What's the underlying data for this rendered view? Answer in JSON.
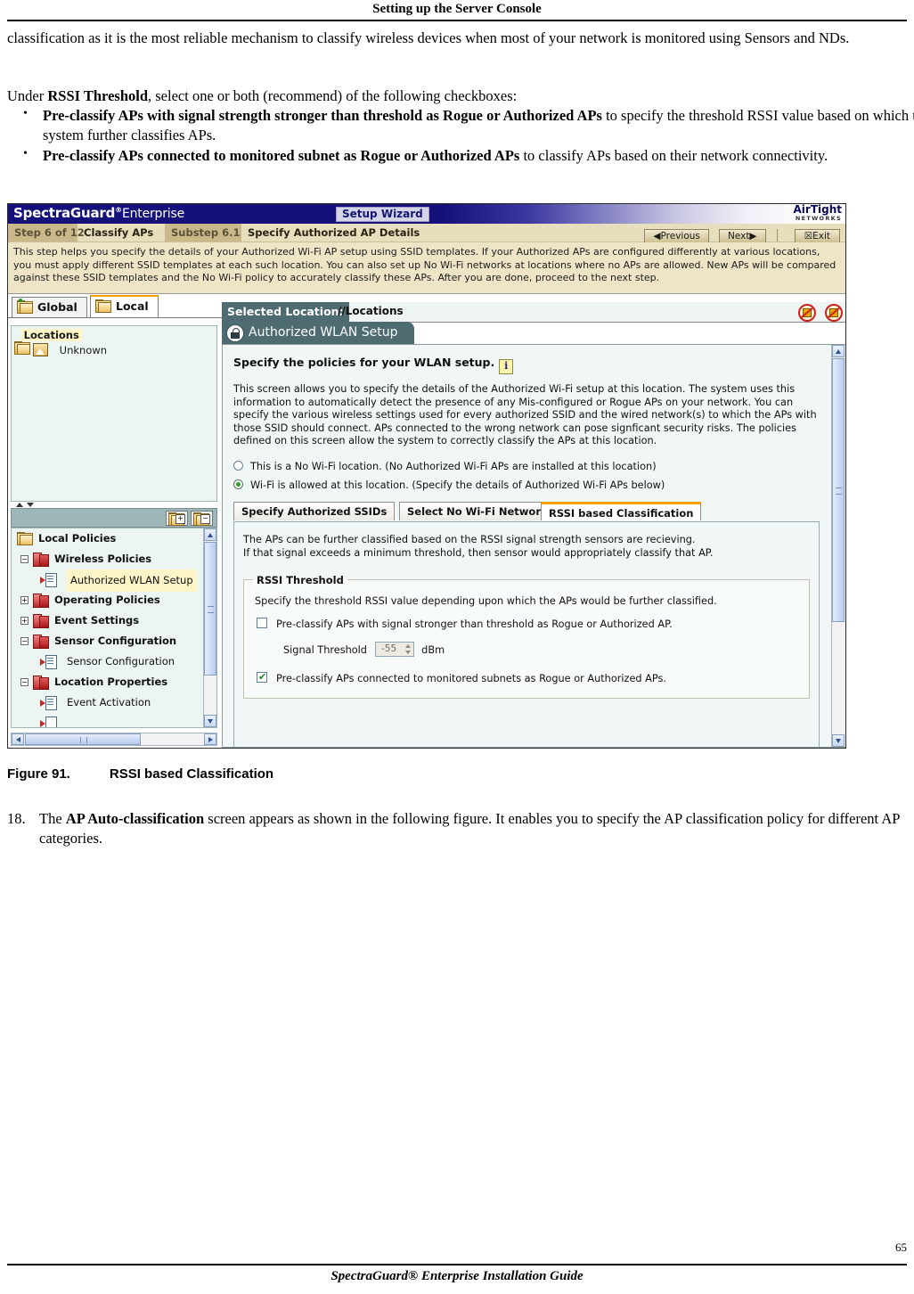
{
  "page": {
    "running_head": "Setting up the Server Console",
    "footer": "SpectraGuard®  Enterprise Installation Guide",
    "page_number": "65"
  },
  "prose": {
    "para1": "classification as it is the most reliable mechanism to classify wireless devices when most of your network is monitored using Sensors and NDs.",
    "para2_pre": "Under ",
    "para2_bold": "RSSI Threshold",
    "para2_post": ", select one or both (recommend) of the following checkboxes:",
    "bullets": [
      {
        "bold": "Pre-classify APs with signal strength stronger than threshold as Rogue or Authorized APs",
        "rest": " to specify the threshold RSSI value based on which the system further classifies APs."
      },
      {
        "bold": "Pre-classify APs connected to monitored subnet as Rogue or Authorized APs",
        "rest": " to classify APs based on their network connectivity."
      }
    ],
    "figure_label": "Figure  91.",
    "figure_title": "RSSI based Classification",
    "step_number": "18.",
    "step_pre": "The ",
    "step_bold": "AP Auto-classification",
    "step_post": " screen appears as shown in the following figure. It enables you to specify the AP classification policy for different AP categories."
  },
  "app": {
    "brand_main": "SpectraGuard",
    "brand_sup": "®",
    "brand_sub": "Enterprise",
    "wizard_chip": "Setup Wizard",
    "logo_line1": "AirTight",
    "logo_line2": "NETWORKS",
    "step_bar": {
      "step": "Step 6 of 12",
      "step_title": "Classify APs",
      "substep": "Substep 6.1",
      "substep_title": "Specify Authorized AP Details",
      "previous": "◀Previous",
      "next": "Next▶",
      "exit": "☒Exit"
    },
    "description": "This step helps you specify the details of your Authorized Wi-Fi AP setup using SSID templates. If your Authorized APs are configured differently at various locations, you must apply different SSID templates at each such location. You can also set up No Wi-Fi networks at locations where no APs are allowed. New APs will be compared against these SSID templates and the No Wi-Fi policy to accurately classify these APs. After you are done, proceed to the next step.",
    "location_tabs": [
      {
        "label": "Global",
        "active": false
      },
      {
        "label": "Local",
        "active": true
      }
    ],
    "selected_location": {
      "label": "Selected Location:",
      "value": "//Locations"
    },
    "location_tree": [
      {
        "label": "Locations",
        "highlighted": true
      },
      {
        "label": "Unknown",
        "highlighted": false
      }
    ],
    "policy_tree": [
      {
        "label": "Local Policies",
        "icon": "folder-icon",
        "indent": 0,
        "expander": "",
        "highlighted": false
      },
      {
        "label": "Wireless Policies",
        "icon": "policy-icon",
        "indent": 1,
        "expander": "−",
        "highlighted": false
      },
      {
        "label": "Authorized WLAN Setup",
        "icon": "document-icon",
        "indent": 2,
        "expander": "",
        "highlighted": true
      },
      {
        "label": "Operating Policies",
        "icon": "policy-icon",
        "indent": 1,
        "expander": "+",
        "highlighted": false
      },
      {
        "label": "Event Settings",
        "icon": "policy-icon",
        "indent": 1,
        "expander": "+",
        "highlighted": false
      },
      {
        "label": "Sensor Configuration",
        "icon": "policy-icon",
        "indent": 1,
        "expander": "−",
        "highlighted": false
      },
      {
        "label": "Sensor Configuration",
        "icon": "document-icon",
        "indent": 2,
        "expander": "",
        "highlighted": false
      },
      {
        "label": "Location Properties",
        "icon": "policy-icon",
        "indent": 1,
        "expander": "−",
        "highlighted": false
      },
      {
        "label": "Event Activation",
        "icon": "document-icon",
        "indent": 2,
        "expander": "",
        "highlighted": false
      }
    ],
    "panel": {
      "tab_title": "Authorized WLAN Setup",
      "heading": "Specify the policies for your WLAN setup.",
      "info_glyph": "i",
      "intro": "This screen allows you to specify the details of the Authorized Wi-Fi setup at this location. The system uses this information to automatically detect the presence of any Mis-configured or Rogue APs on your network. You can specify the various wireless settings used for every authorized SSID and the wired network(s) to which the APs with those SSID should connect. APs connected to the wrong network can pose signficant security risks. The policies defined on this screen allow the system to correctly classify the APs at this location.",
      "radios": [
        {
          "label": "This is a No Wi-Fi location. (No Authorized Wi-Fi APs are installed at this location)",
          "selected": false
        },
        {
          "label": "Wi-Fi is allowed at this location. (Specify the details of Authorized Wi-Fi APs below)",
          "selected": true
        }
      ],
      "inner_tabs": [
        {
          "label": "Specify Authorized SSIDs",
          "active": false
        },
        {
          "label": "Select No Wi-Fi Networks",
          "active": false
        },
        {
          "label": "RSSI based Classification",
          "active": true
        }
      ],
      "rssi_tab": {
        "line1": "The APs can be further classified based on the RSSI signal strength sensors are recieving.",
        "line2": "If that signal exceeds a minimum threshold, then sensor would appropriately classify that AP.",
        "fieldset_legend": "RSSI Threshold",
        "fieldset_text": "Specify the threshold RSSI value depending upon which the APs would be further classified.",
        "checkbox1": {
          "label": "Pre-classify APs with signal stronger than threshold as Rogue or Authorized AP.",
          "checked": false
        },
        "threshold_label": "Signal Threshold",
        "threshold_value": "-55",
        "threshold_unit": "dBm",
        "checkbox2": {
          "label": "Pre-classify APs connected to monitored subnets as Rogue or Authorized APs.",
          "checked": true
        }
      }
    }
  },
  "colors": {
    "titlebar_blue": "#15117a",
    "step_bar_bg": "#e6debd",
    "step_seg_dark": "#c9b98a",
    "description_bg": "#ede5c6",
    "panel_header_teal": "#4d6b70",
    "panel_bg": "#f0f7f6",
    "active_tab_accent": "#f5a200",
    "highlight_yellow": "#fdf4c8"
  }
}
